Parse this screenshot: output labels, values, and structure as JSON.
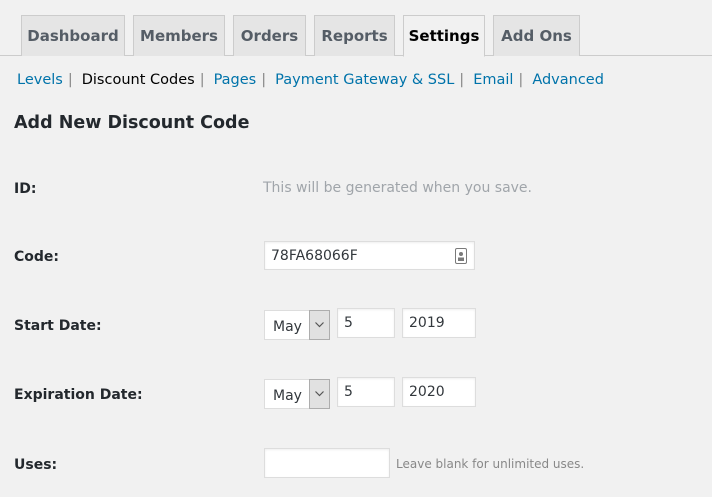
{
  "tabs": [
    {
      "label": "Dashboard"
    },
    {
      "label": "Members"
    },
    {
      "label": "Orders"
    },
    {
      "label": "Reports"
    },
    {
      "label": "Settings",
      "active": true
    },
    {
      "label": "Add Ons"
    }
  ],
  "subnav": [
    {
      "label": "Levels"
    },
    {
      "label": "Discount Codes",
      "current": true
    },
    {
      "label": "Pages"
    },
    {
      "label": "Payment Gateway & SSL"
    },
    {
      "label": "Email"
    },
    {
      "label": "Advanced"
    }
  ],
  "subnav_separator": "|",
  "heading": "Add New Discount Code",
  "form": {
    "id": {
      "label": "ID:",
      "hint": "This will be generated when you save."
    },
    "code": {
      "label": "Code:",
      "value": "78FA68066F",
      "icon": "key-icon"
    },
    "start_date": {
      "label": "Start Date:",
      "month": "May",
      "day": "5",
      "year": "2019"
    },
    "expiration_date": {
      "label": "Expiration Date:",
      "month": "May",
      "day": "5",
      "year": "2020"
    },
    "uses": {
      "label": "Uses:",
      "value": "",
      "hint": "Leave blank for unlimited uses."
    }
  },
  "colors": {
    "link": "#0073aa",
    "background": "#f1f1f1",
    "tab_inactive": "#e5e5e5"
  }
}
